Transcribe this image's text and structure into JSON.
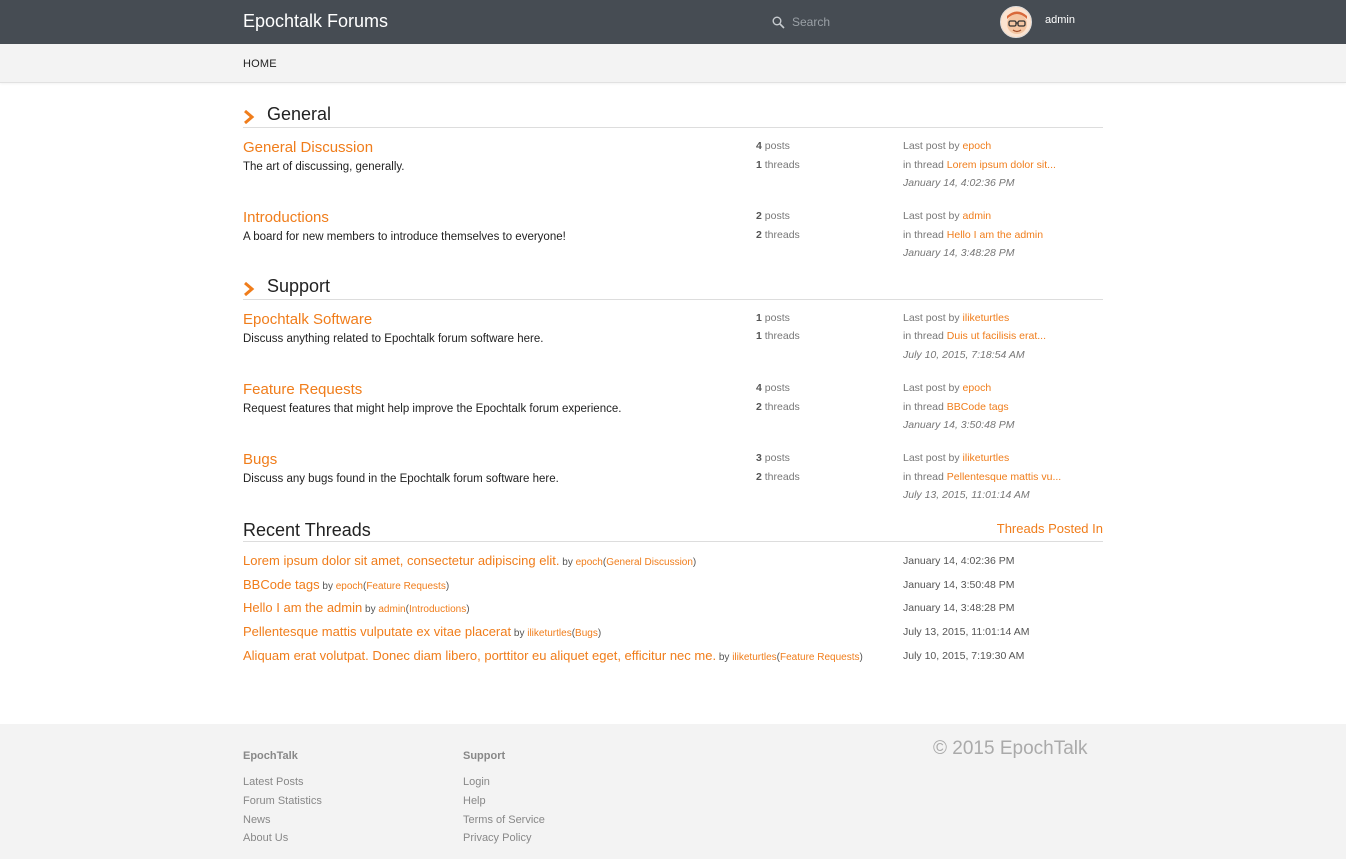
{
  "header": {
    "brand": "Epochtalk Forums",
    "search_placeholder": "Search",
    "username": "admin"
  },
  "nav": {
    "home": "HOME"
  },
  "labels": {
    "posts": "posts",
    "threads": "threads",
    "last_post_by": "Last post by",
    "in_thread": "in thread",
    "by": "by"
  },
  "categories": [
    {
      "title": "General",
      "boards": [
        {
          "name": "General Discussion",
          "description": "The art of discussing, generally.",
          "posts": "4",
          "threads": "1",
          "last_user": "epoch",
          "last_thread": "Lorem ipsum dolor sit...",
          "last_date": "January 14, 4:02:36 PM"
        },
        {
          "name": "Introductions",
          "description": "A board for new members to introduce themselves to everyone!",
          "posts": "2",
          "threads": "2",
          "last_user": "admin",
          "last_thread": "Hello I am the admin",
          "last_date": "January 14, 3:48:28 PM"
        }
      ]
    },
    {
      "title": "Support",
      "boards": [
        {
          "name": "Epochtalk Software",
          "description": "Discuss anything related to Epochtalk forum software here.",
          "posts": "1",
          "threads": "1",
          "last_user": "iliketurtles",
          "last_thread": "Duis ut facilisis erat...",
          "last_date": "July 10, 2015, 7:18:54 AM"
        },
        {
          "name": "Feature Requests",
          "description": "Request features that might help improve the Epochtalk forum experience.",
          "posts": "4",
          "threads": "2",
          "last_user": "epoch",
          "last_thread": "BBCode tags",
          "last_date": "January 14, 3:50:48 PM"
        },
        {
          "name": "Bugs",
          "description": "Discuss any bugs found in the Epochtalk forum software here.",
          "posts": "3",
          "threads": "2",
          "last_user": "iliketurtles",
          "last_thread": "Pellentesque mattis vu...",
          "last_date": "July 13, 2015, 11:01:14 AM"
        }
      ]
    }
  ],
  "recent": {
    "title": "Recent Threads",
    "link": "Threads Posted In",
    "threads": [
      {
        "title": "Lorem ipsum dolor sit amet, consectetur adipiscing elit.",
        "user": "epoch",
        "board": "General Discussion",
        "date": "January 14, 4:02:36 PM"
      },
      {
        "title": "BBCode tags",
        "user": "epoch",
        "board": "Feature Requests",
        "date": "January 14, 3:50:48 PM"
      },
      {
        "title": "Hello I am the admin",
        "user": "admin",
        "board": "Introductions",
        "date": "January 14, 3:48:28 PM"
      },
      {
        "title": "Pellentesque mattis vulputate ex vitae placerat",
        "user": "iliketurtles",
        "board": "Bugs",
        "date": "July 13, 2015, 11:01:14 AM"
      },
      {
        "title": "Aliquam erat volutpat. Donec diam libero, porttitor eu aliquet eget, efficitur nec me.",
        "user": "iliketurtles",
        "board": "Feature Requests",
        "date": "July 10, 2015, 7:19:30 AM"
      }
    ]
  },
  "footer": {
    "col1": {
      "title": "EpochTalk",
      "links": [
        "Latest Posts",
        "Forum Statistics",
        "News",
        "About Us"
      ]
    },
    "col2": {
      "title": "Support",
      "links": [
        "Login",
        "Help",
        "Terms of Service",
        "Privacy Policy"
      ]
    },
    "copyright": "© 2015 EpochTalk"
  },
  "colors": {
    "accent": "#f07d1b",
    "topbar": "#464c53",
    "footer_bg": "#f3f3f3"
  }
}
